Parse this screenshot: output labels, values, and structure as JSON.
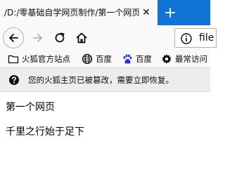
{
  "tab": {
    "title": "/D:/零基础自学网页制作/第一个网页",
    "close_glyph": "✕",
    "new_tab_glyph": "+"
  },
  "navbar": {
    "url": "file"
  },
  "bookmarks": [
    {
      "label": "火狐官方站点",
      "icon": "folder-icon"
    },
    {
      "label": "百度",
      "icon": "globe-icon"
    },
    {
      "label": "百度",
      "icon": "paw-icon"
    },
    {
      "label": "最常访问",
      "icon": "gear-icon"
    }
  ],
  "notice": {
    "text": "您的火狐主页已被篡改，需要立即恢复。"
  },
  "page": {
    "heading": "第一个网页",
    "line": "千里之行始于足下"
  },
  "colors": {
    "tabstrip": "#1173d6",
    "toolbar": "#f9f9fa",
    "notice_bg": "#ededf0"
  }
}
